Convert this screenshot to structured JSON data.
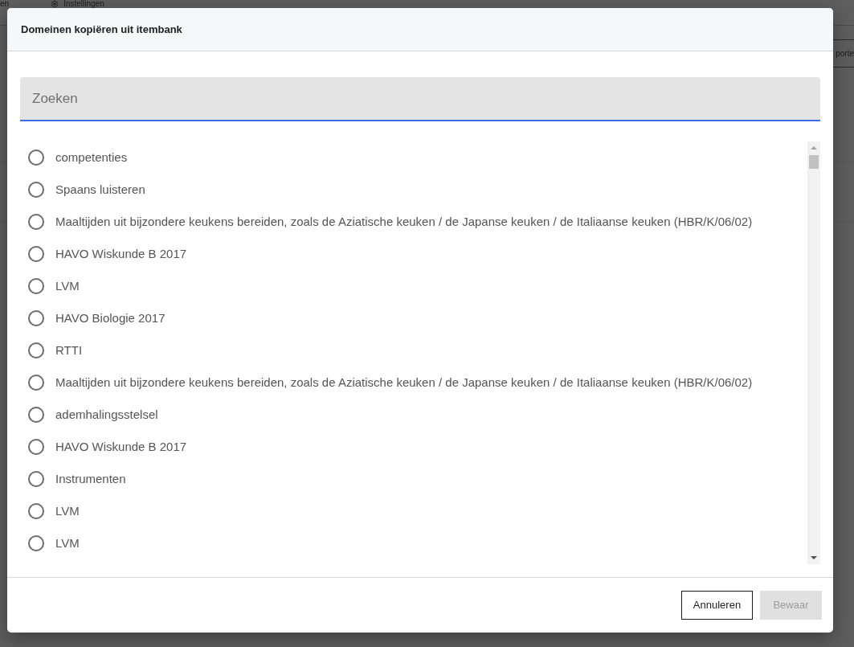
{
  "background": {
    "nav_items": [
      {
        "kind": "text",
        "label": "en"
      },
      {
        "kind": "icon",
        "label": "Instellingen"
      }
    ],
    "button": {
      "label": "porte"
    }
  },
  "dialog": {
    "title": "Domeinen kopiëren uit itembank",
    "search": {
      "placeholder": "Zoeken",
      "focused": true
    },
    "options": [
      {
        "label": "competenties",
        "selected": false
      },
      {
        "label": "Spaans luisteren",
        "selected": false
      },
      {
        "label": "Maaltijden uit bijzondere keukens bereiden, zoals de Aziatische keuken / de Japanse keuken / de Italiaanse keuken (HBR/K/06/02)",
        "selected": false
      },
      {
        "label": "HAVO Wiskunde B 2017",
        "selected": false
      },
      {
        "label": "LVM",
        "selected": false
      },
      {
        "label": "HAVO Biologie 2017",
        "selected": false
      },
      {
        "label": "RTTI",
        "selected": false
      },
      {
        "label": "Maaltijden uit bijzondere keukens bereiden, zoals de Aziatische keuken / de Japanse keuken / de Italiaanse keuken (HBR/K/06/02)",
        "selected": false
      },
      {
        "label": "ademhalingsstelsel",
        "selected": false
      },
      {
        "label": "HAVO Wiskunde B 2017",
        "selected": false
      },
      {
        "label": "Instrumenten",
        "selected": false
      },
      {
        "label": "LVM",
        "selected": false
      },
      {
        "label": "LVM",
        "selected": false
      }
    ],
    "buttons": [
      {
        "label": "Annuleren",
        "kind": "outline",
        "disabled": false
      },
      {
        "label": "Bewaar",
        "kind": "primary",
        "disabled": true
      }
    ]
  }
}
